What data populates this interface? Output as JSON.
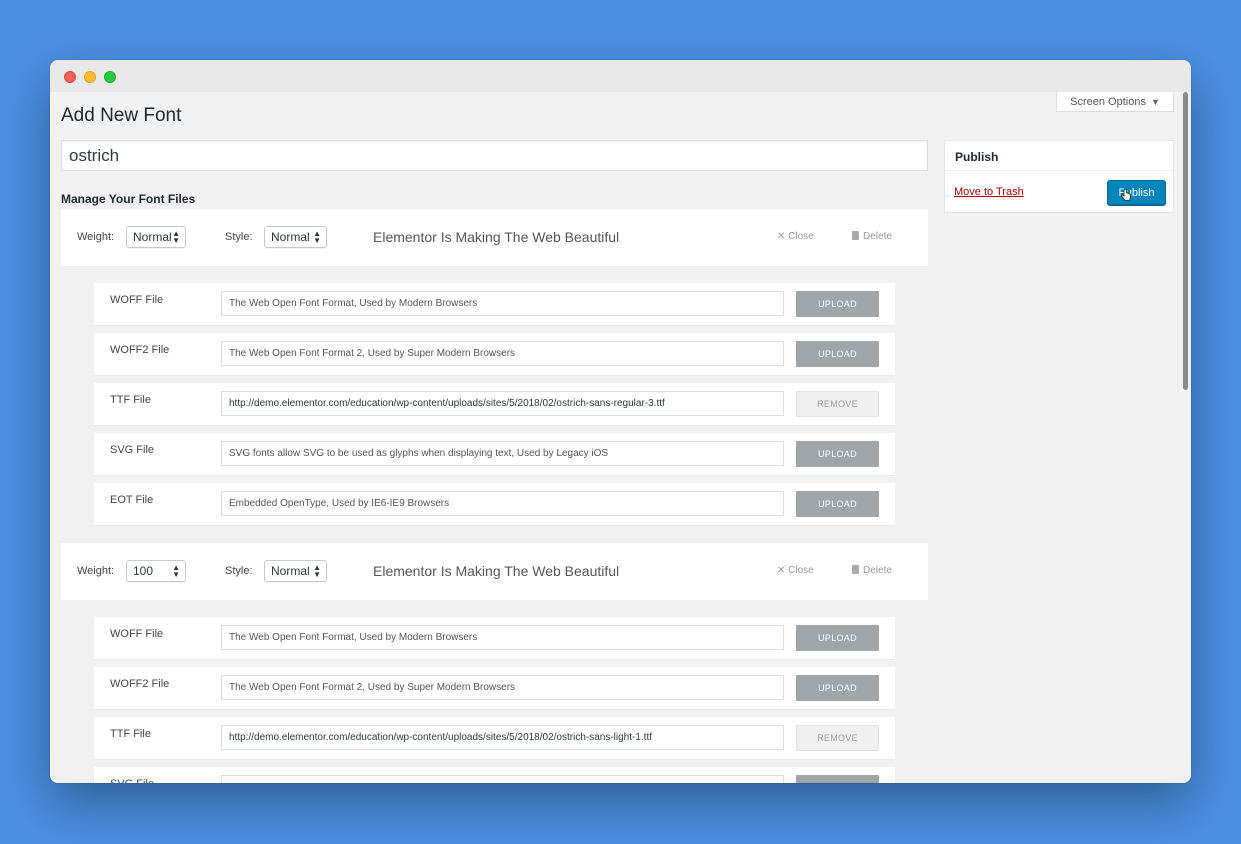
{
  "page": {
    "title": "Add New Font",
    "font_name_value": "ostrich",
    "section_label": "Manage Your Font Files",
    "screen_options": "Screen Options"
  },
  "publish": {
    "heading": "Publish",
    "trash_link": "Move to Trash",
    "button": "Publish"
  },
  "common": {
    "weight_label": "Weight:",
    "style_label": "Style:",
    "close": "Close",
    "delete": "Delete",
    "preview_text": "Elementor Is Making The Web Beautiful",
    "upload": "UPLOAD",
    "remove": "REMOVE"
  },
  "font_blocks": [
    {
      "weight": "Normal",
      "style": "Normal",
      "files": [
        {
          "label": "WOFF File",
          "value": "The Web Open Font Format, Used by Modern Browsers",
          "action": "UPLOAD"
        },
        {
          "label": "WOFF2 File",
          "value": "The Web Open Font Format 2, Used by Super Modern Browsers",
          "action": "UPLOAD"
        },
        {
          "label": "TTF File",
          "value": "http://demo.elementor.com/education/wp-content/uploads/sites/5/2018/02/ostrich-sans-regular-3.ttf",
          "action": "REMOVE"
        },
        {
          "label": "SVG File",
          "value": "SVG fonts allow SVG to be used as glyphs when displaying text, Used by Legacy iOS",
          "action": "UPLOAD"
        },
        {
          "label": "EOT File",
          "value": "Embedded OpenType, Used by IE6-IE9 Browsers",
          "action": "UPLOAD"
        }
      ]
    },
    {
      "weight": "100",
      "style": "Normal",
      "files": [
        {
          "label": "WOFF File",
          "value": "The Web Open Font Format, Used by Modern Browsers",
          "action": "UPLOAD"
        },
        {
          "label": "WOFF2 File",
          "value": "The Web Open Font Format 2, Used by Super Modern Browsers",
          "action": "UPLOAD"
        },
        {
          "label": "TTF File",
          "value": "http://demo.elementor.com/education/wp-content/uploads/sites/5/2018/02/ostrich-sans-light-1.ttf",
          "action": "REMOVE"
        },
        {
          "label": "SVG File",
          "value": "",
          "action": "UPLOAD"
        }
      ]
    }
  ],
  "colors": {
    "background": "#4a90e2",
    "publish_button": "#0085ba",
    "upload_button": "#a0a5aa",
    "trash_link": "#aa0000"
  }
}
